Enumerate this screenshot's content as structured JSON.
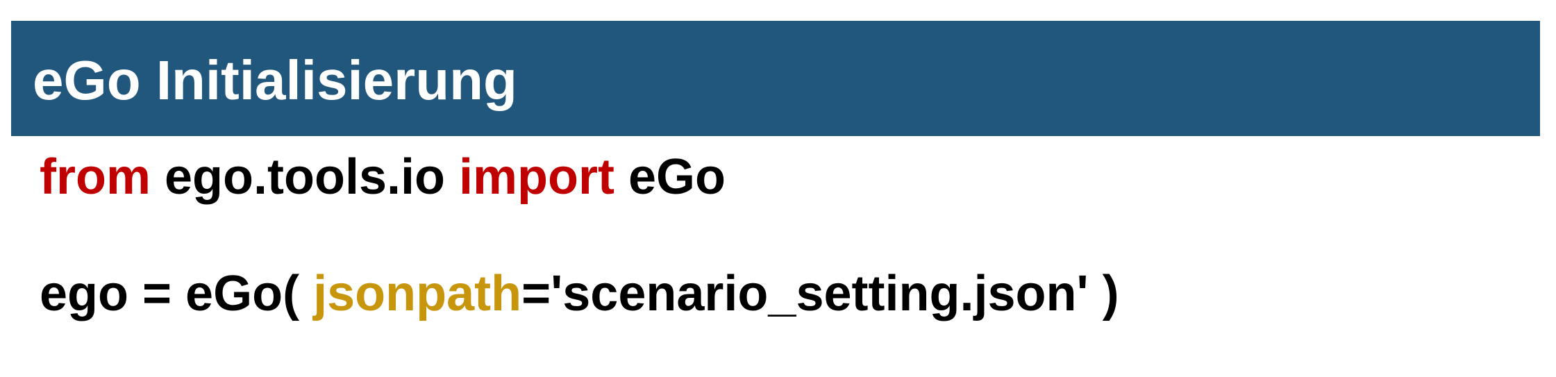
{
  "header": {
    "title": "eGo Initialisierung"
  },
  "code": {
    "line1": {
      "kw_from": "from",
      "module": " ego.tools.io ",
      "kw_import": "import",
      "name": " eGo"
    },
    "line2": {
      "prefix": "ego = eGo( ",
      "param": "jsonpath",
      "suffix": "='scenario_setting.json' )"
    }
  },
  "colors": {
    "header_background": "#21577d",
    "header_text": "#ffffff",
    "keyword": "#c00000",
    "parameter": "#c8960c",
    "code_text": "#000000"
  }
}
